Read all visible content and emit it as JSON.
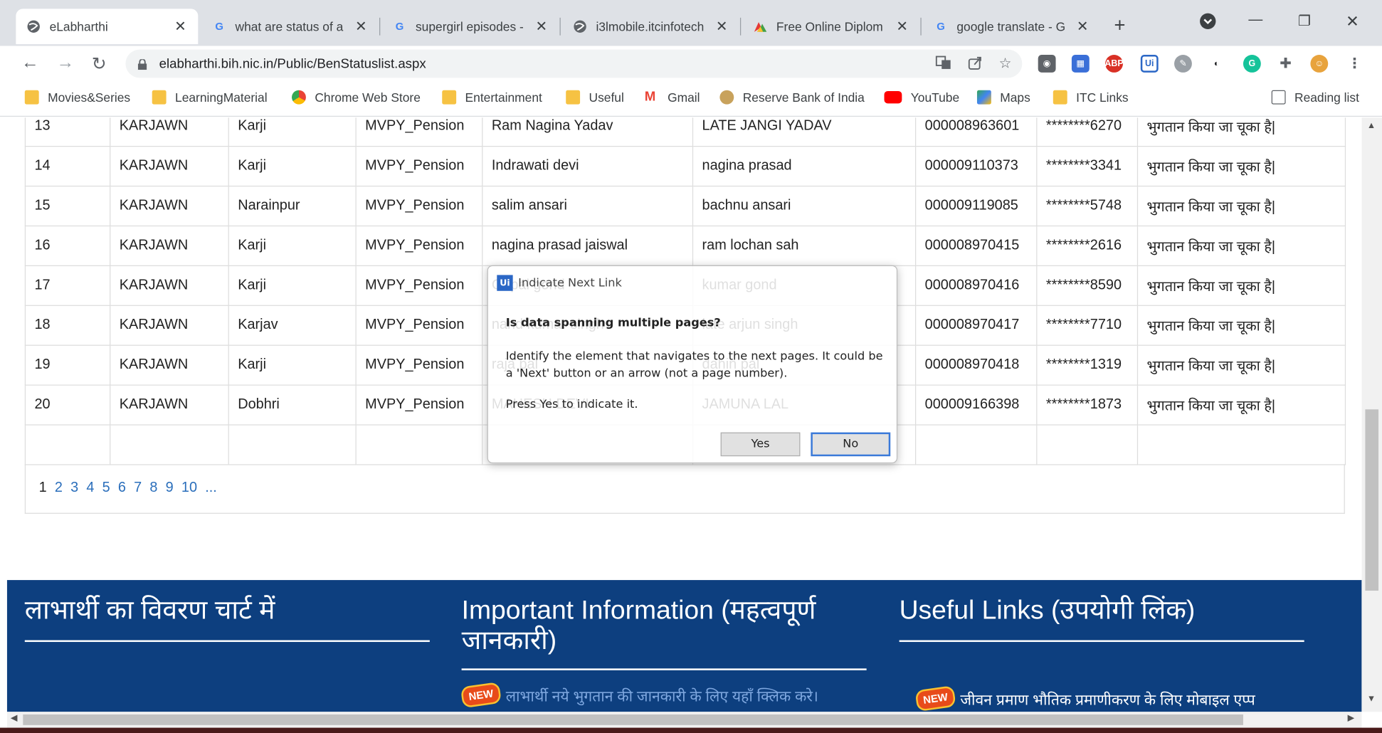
{
  "browser": {
    "tabs": [
      {
        "title": "eLabharthi",
        "favicon": "globe-icon",
        "active": true
      },
      {
        "title": "what are status of a",
        "favicon": "google-icon"
      },
      {
        "title": "supergirl episodes -",
        "favicon": "google-icon"
      },
      {
        "title": "i3lmobile.itcinfotech",
        "favicon": "globe-icon"
      },
      {
        "title": "Free Online Diplom",
        "favicon": "alison-icon"
      },
      {
        "title": "google translate - G",
        "favicon": "google-icon"
      }
    ],
    "url": "elabharthi.bih.nic.in/Public/BenStatuslist.aspx",
    "bookmarks": [
      {
        "label": "Movies&Series",
        "icon": "folder-icon"
      },
      {
        "label": "LearningMaterial",
        "icon": "folder-icon"
      },
      {
        "label": "Chrome Web Store",
        "icon": "chrome-web-store-icon"
      },
      {
        "label": "Entertainment",
        "icon": "folder-icon"
      },
      {
        "label": "Useful",
        "icon": "folder-icon"
      },
      {
        "label": "Gmail",
        "icon": "gmail-icon"
      },
      {
        "label": "Reserve Bank of India",
        "icon": "rbi-icon"
      },
      {
        "label": "YouTube",
        "icon": "youtube-icon"
      },
      {
        "label": "Maps",
        "icon": "maps-icon"
      },
      {
        "label": "ITC Links",
        "icon": "folder-icon"
      }
    ],
    "reading_list": "Reading list"
  },
  "table": {
    "rows": [
      [
        "13",
        "KARJAWN",
        "Karji",
        "MVPY_Pension",
        "Ram Nagina Yadav",
        "LATE JANGI YADAV",
        "000008963601",
        "********6270",
        "भुगतान किया जा चूका है|"
      ],
      [
        "14",
        "KARJAWN",
        "Karji",
        "MVPY_Pension",
        "Indrawati devi",
        "nagina prasad",
        "000009110373",
        "********3341",
        "भुगतान किया जा चूका है|"
      ],
      [
        "15",
        "KARJAWN",
        "Narainpur",
        "MVPY_Pension",
        "salim ansari",
        "bachnu ansari",
        "000009119085",
        "********5748",
        "भुगतान किया जा चूका है|"
      ],
      [
        "16",
        "KARJAWN",
        "Karji",
        "MVPY_Pension",
        "nagina prasad jaiswal",
        "ram lochan sah",
        "000008970415",
        "********2616",
        "भुगतान किया जा चूका है|"
      ],
      [
        "17",
        "KARJAWN",
        "Karji",
        "MVPY_Pension",
        "Gopal gond",
        "kumar gond",
        "000008970416",
        "********8590",
        "भुगतान किया जा चूका है|"
      ],
      [
        "18",
        "KARJAWN",
        "Karjav",
        "MVPY_Pension",
        "nand kumar singh",
        "late arjun singh",
        "000008970417",
        "********7710",
        "भुगतान किया जा चूका है|"
      ],
      [
        "19",
        "KARJAWN",
        "Karji",
        "MVPY_Pension",
        "raja pal",
        "dahin pal",
        "000008970418",
        "********1319",
        "भुगतान किया जा चूका है|"
      ],
      [
        "20",
        "KARJAWN",
        "Dobhri",
        "MVPY_Pension",
        "MAHESH DEVI",
        "JAMUNA LAL",
        "000009166398",
        "********1873",
        "भुगतान किया जा चूका है|"
      ]
    ],
    "pages": [
      "1",
      "2",
      "3",
      "4",
      "5",
      "6",
      "7",
      "8",
      "9",
      "10",
      "..."
    ],
    "current_page": "1"
  },
  "footer": {
    "col1_title": "लाभार्थी का विवरण चार्ट में",
    "col2_title": "Important Information (महत्वपूर्ण जानकारी)",
    "col3_title": "Useful Links (उपयोगी लिंक)",
    "new_badge": "NEW",
    "col2_link": "लाभार्थी नये भुगतान की जानकारी के लिए यहाँ क्लिक करे।",
    "col3_link": "जीवन प्रमाण भौतिक प्रमाणीकरण के लिए मोबाइल एप्प"
  },
  "dialog": {
    "title": "Indicate Next Link",
    "logo": "Ui",
    "question": "Is data spanning multiple pages?",
    "body": "Identify the element that navigates to the next pages. It could be a 'Next' button or an arrow (not a page number).",
    "press": "Press Yes to indicate it.",
    "yes_label": "Yes",
    "no_label": "No"
  },
  "colors": {
    "footer_bg": "#0d3f7f",
    "link": "#2a6ebb",
    "dialog_focus": "#3b7ad9"
  }
}
